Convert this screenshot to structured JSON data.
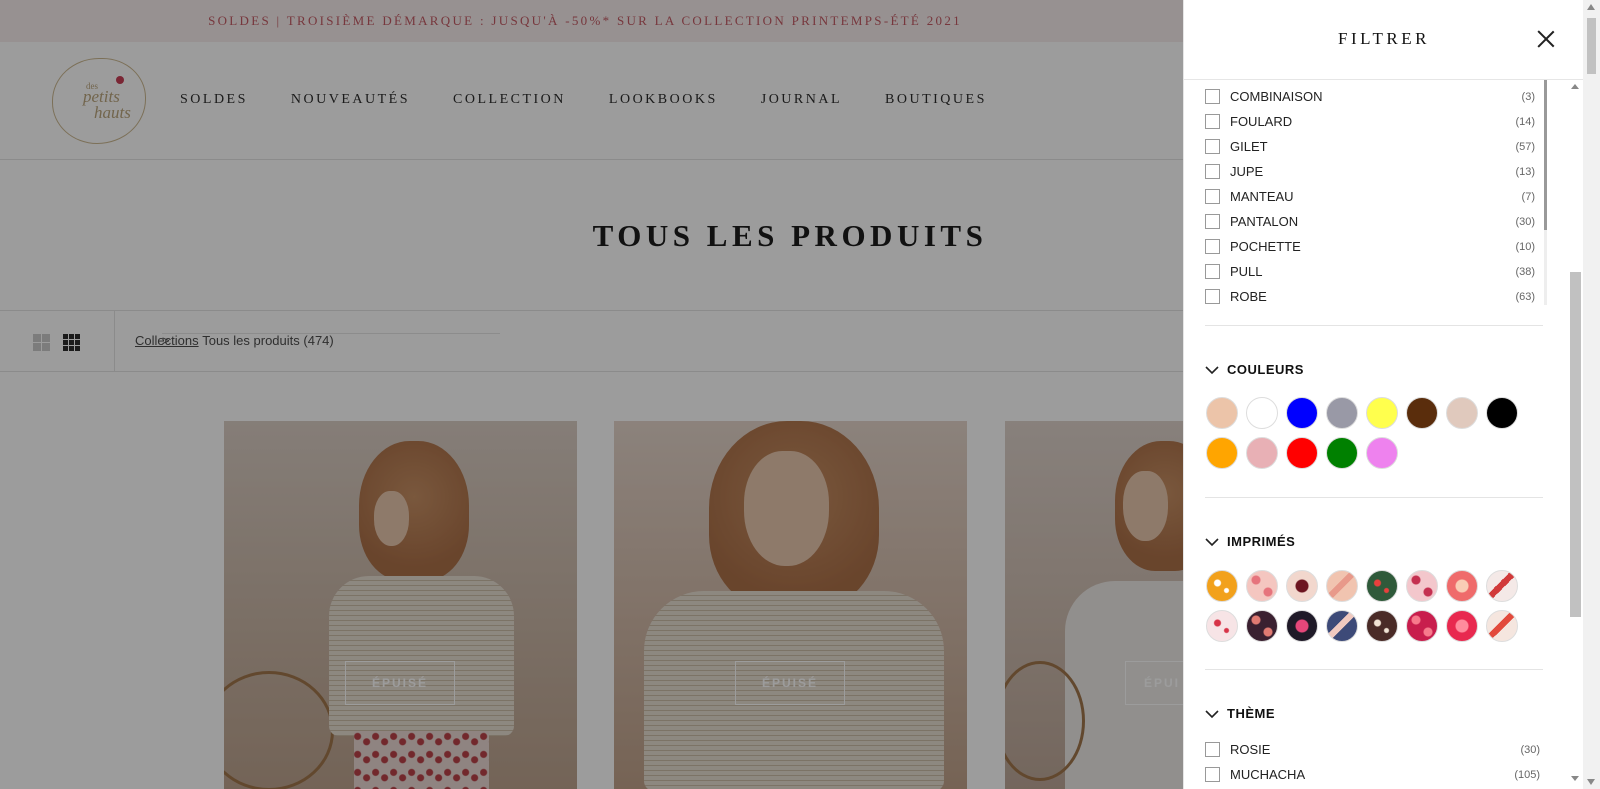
{
  "announcement": "SOLDES | TROISIÈME DÉMARQUE : JUSQU'À -50%* SUR LA COLLECTION PRINTEMPS-ÉTÉ 2021",
  "logo": {
    "line1": "des",
    "line2": "petits",
    "line3": "hauts"
  },
  "nav": [
    "SOLDES",
    "NOUVEAUTÉS",
    "COLLECTION",
    "LOOKBOOKS",
    "JOURNAL",
    "BOUTIQUES"
  ],
  "page_title": "TOUS LES PRODUITS",
  "breadcrumb": {
    "link": "Collections",
    "separator": ">",
    "current": "Tous les produits (474)"
  },
  "products": [
    {
      "badge": "ÉPUISÉ"
    },
    {
      "badge": "ÉPUISÉ"
    },
    {
      "badge": "ÉPUI"
    }
  ],
  "filter": {
    "title": "FILTRER",
    "types": [
      {
        "label": "COMBINAISON",
        "count": "(3)"
      },
      {
        "label": "FOULARD",
        "count": "(14)"
      },
      {
        "label": "GILET",
        "count": "(57)"
      },
      {
        "label": "JUPE",
        "count": "(13)"
      },
      {
        "label": "MANTEAU",
        "count": "(7)"
      },
      {
        "label": "PANTALON",
        "count": "(30)"
      },
      {
        "label": "POCHETTE",
        "count": "(10)"
      },
      {
        "label": "PULL",
        "count": "(38)"
      },
      {
        "label": "ROBE",
        "count": "(63)"
      }
    ],
    "colors_title": "COULEURS",
    "colors": [
      "#ecc4a9",
      "#ffffff",
      "#0000ff",
      "#9999a6",
      "#ffff4d",
      "#5a2d0c",
      "#e0c9bd",
      "#000000",
      "#ffa500",
      "#e8b0b5",
      "#ff0000",
      "#008000",
      "#ee82ee"
    ],
    "prints_title": "IMPRIMÉS",
    "prints": [
      {
        "base": "#f2a11c",
        "accent": "#ffffff"
      },
      {
        "base": "#f4c6c0",
        "accent": "#e6747d"
      },
      {
        "base": "#f2d7cd",
        "accent": "#6d1520"
      },
      {
        "base": "#f1c4b0",
        "accent": "#e8998a"
      },
      {
        "base": "#2f5a3a",
        "accent": "#e8403d"
      },
      {
        "base": "#f3c7cc",
        "accent": "#c43050"
      },
      {
        "base": "#ef6b6b",
        "accent": "#f9cdb5"
      },
      {
        "base": "#f4e9e7",
        "accent": "#d13a3a"
      },
      {
        "base": "#f7e4e6",
        "accent": "#d73448"
      },
      {
        "base": "#3a2030",
        "accent": "#e07a72"
      },
      {
        "base": "#1f1a28",
        "accent": "#e5477a"
      },
      {
        "base": "#3d4a78",
        "accent": "#f0c9c0"
      },
      {
        "base": "#4a2b27",
        "accent": "#f1e3d4"
      },
      {
        "base": "#c81e4d",
        "accent": "#f77a8c"
      },
      {
        "base": "#e8294f",
        "accent": "#ff8c9d"
      },
      {
        "base": "#f5e6df",
        "accent": "#e24a3c"
      }
    ],
    "theme_title": "THÈME",
    "themes": [
      {
        "label": "ROSIE",
        "count": "(30)"
      },
      {
        "label": "MUCHACHA",
        "count": "(105)"
      }
    ]
  }
}
